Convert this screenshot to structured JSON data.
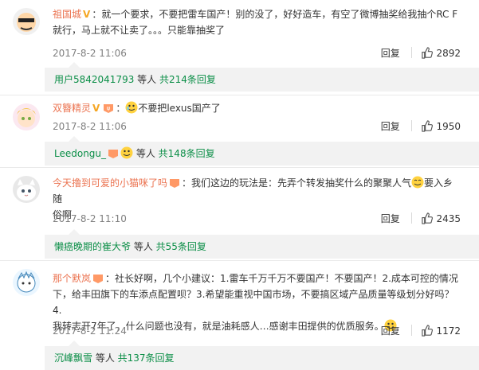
{
  "comments": [
    {
      "user": "祖国城",
      "text1": "：就一个要求，不要把雷车国产！别的没了，好好造车，有空了微博抽奖给我抽个RC F",
      "text2": "就行，马上就不让卖了。。。只能靠抽奖了",
      "time": "2017-8-2 11:06",
      "reply": "回复",
      "likes": "2892",
      "sub_user": "用户5842041793",
      "sub_mid": " 等人 ",
      "sub_count": "共214条回复"
    },
    {
      "user": "双簪精灵",
      "text1": "不要把lexus国产了",
      "time": "2017-8-2 11:06",
      "reply": "回复",
      "likes": "1950",
      "sub_user": "Leedongu_",
      "sub_mid": " 等人 ",
      "sub_count": "共148条回复"
    },
    {
      "user": "今天撸到可爱的小猫咪了吗",
      "text1": "：我们这边的玩法是：先弄个转发抽奖什么的聚聚人气",
      "text1b": "要入乡随",
      "text2": "俗啊",
      "time": "2017-8-2 11:10",
      "reply": "回复",
      "likes": "2435",
      "sub_user": "懒癌晚期的崔大爷",
      "sub_mid": " 等人 ",
      "sub_count": "共55条回复"
    },
    {
      "user": "那个默岚",
      "text1": "：社长好啊，几个小建议：1.雷车千万千万不要国产！不要国产！2.成本可控的情况",
      "text2": "下，给丰田旗下的车添点配置呗？3.希望能重视中国市场，不要搞区域产品质量等级划分好吗？4.",
      "text3": "我转志开7年了，什么问题也没有，就是油耗感人…感谢丰田提供的优质服务。",
      "time": "2017-8-2 11:24",
      "reply": "回复",
      "likes": "1172",
      "sub_user": "沉峰飘雪",
      "sub_mid": " 等人 ",
      "sub_count": "共137条回复"
    }
  ],
  "colors": {
    "username": "#eb7350",
    "link": "#0b8e47",
    "meta": "#808080",
    "subbox_bg": "#f2f2f2"
  },
  "icons": [
    "avatar",
    "verified-v-icon",
    "vip-icon",
    "emoji-icon",
    "like-icon"
  ]
}
